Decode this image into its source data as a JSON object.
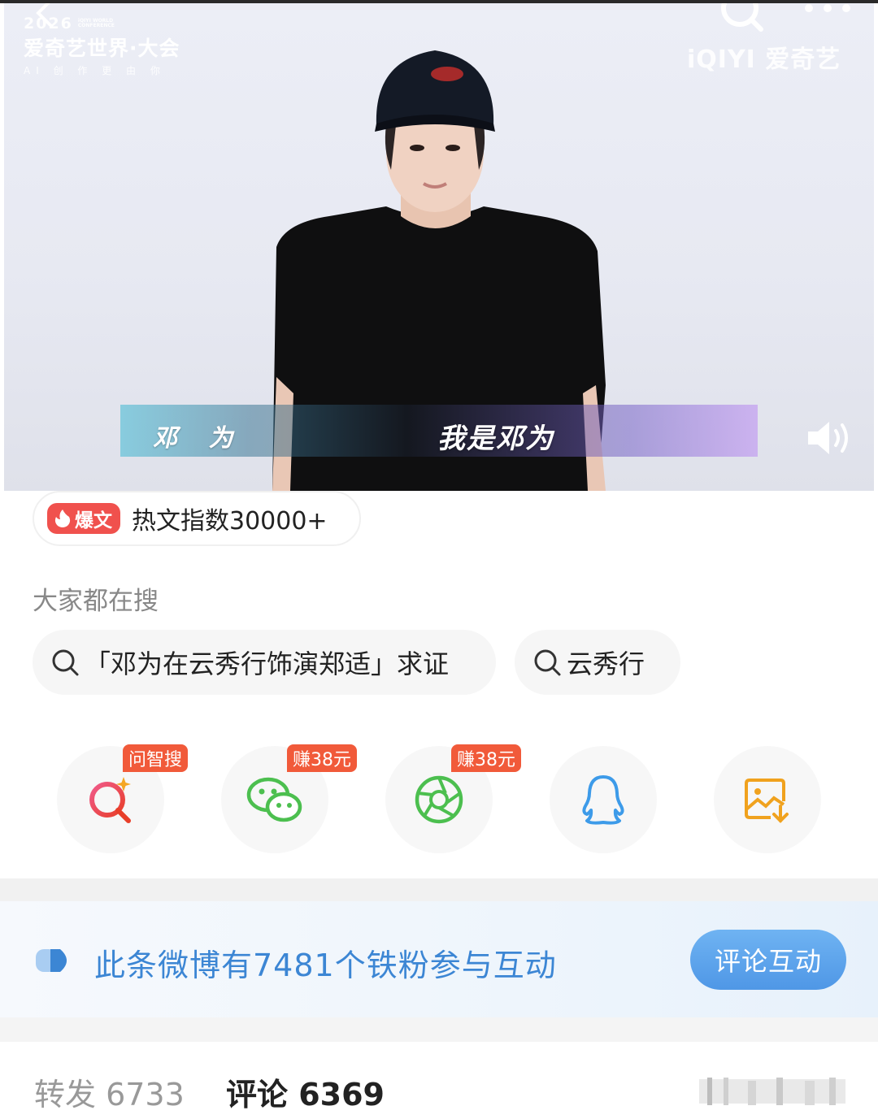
{
  "video": {
    "conference_year": "2026",
    "conference_small": "iQIYI WORLD CONFERENCE",
    "conference_title": "爱奇艺世界·大会",
    "conference_sub": "AI 创 作 更 由 你",
    "brand": "iQIYI 爱奇艺",
    "caption_name": "邓 为",
    "caption_text": "我是邓为"
  },
  "hot": {
    "tag": "爆文",
    "text": "热文指数30000+"
  },
  "search": {
    "heading": "大家都在搜",
    "chips": [
      "「邓为在云秀行饰演郑适」求证",
      "云秀行"
    ]
  },
  "share": {
    "items": [
      {
        "icon": "ai-search-icon",
        "badge": "问智搜",
        "color": "#e8483e"
      },
      {
        "icon": "wechat-icon",
        "badge": "赚38元",
        "color": "#4cbf4f"
      },
      {
        "icon": "moments-icon",
        "badge": "赚38元",
        "color": "#4cbf4f"
      },
      {
        "icon": "qq-icon",
        "badge": "",
        "color": "#3d9be9"
      },
      {
        "icon": "save-image-icon",
        "badge": "",
        "color": "#f0a21e"
      }
    ]
  },
  "fan": {
    "text": "此条微博有7481个铁粉参与互动",
    "button": "评论互动"
  },
  "tabs": {
    "repost": "转发 6733",
    "comment": "评论 6369"
  },
  "colors": {
    "accent_blue": "#3c86d4",
    "hot_red": "#f0514d",
    "badge_orange": "#f15a3a"
  }
}
